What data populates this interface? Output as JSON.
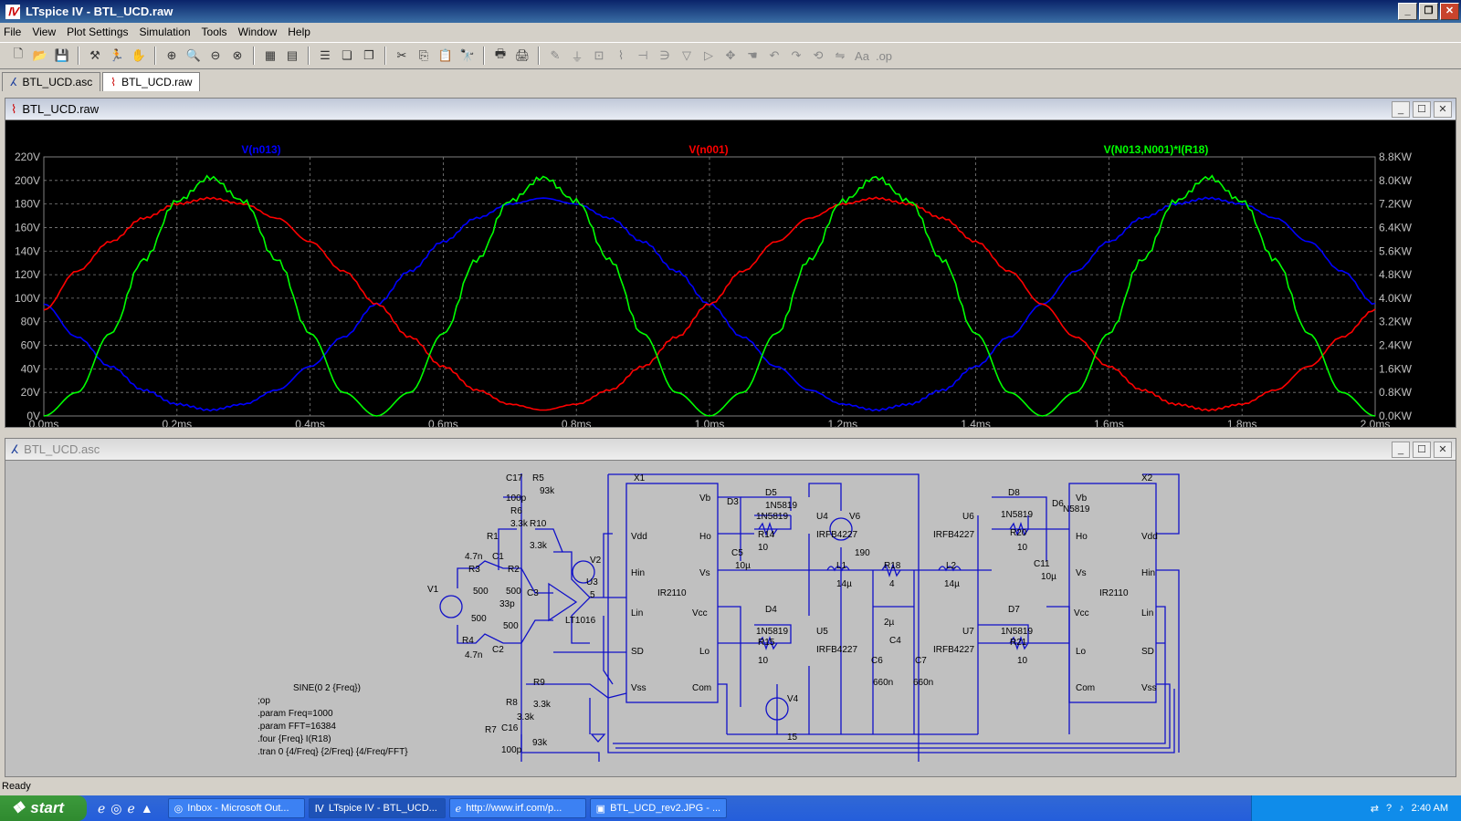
{
  "window": {
    "title": "LTspice IV - BTL_UCD.raw"
  },
  "menu": [
    "File",
    "View",
    "Plot Settings",
    "Simulation",
    "Tools",
    "Window",
    "Help"
  ],
  "tabs": [
    {
      "label": "BTL_UCD.asc"
    },
    {
      "label": "BTL_UCD.raw"
    }
  ],
  "plot_pane": {
    "title": "BTL_UCD.raw"
  },
  "schematic_pane": {
    "title": "BTL_UCD.asc"
  },
  "chart_data": {
    "type": "line",
    "x": [
      0,
      0.05,
      0.1,
      0.15,
      0.2,
      0.25,
      0.3,
      0.35,
      0.4,
      0.45,
      0.5,
      0.55,
      0.6,
      0.65,
      0.7,
      0.75,
      0.8,
      0.85,
      0.9,
      0.95,
      1.0,
      1.05,
      1.1,
      1.15,
      1.2,
      1.25,
      1.3,
      1.35,
      1.4,
      1.45,
      1.5,
      1.55,
      1.6,
      1.65,
      1.7,
      1.75,
      1.8,
      1.85,
      1.9,
      1.95,
      2.0
    ],
    "series": [
      {
        "name": "V(n013)",
        "color": "#0000ff",
        "axis": "left",
        "values": [
          95,
          67,
          42,
          22,
          10,
          5,
          10,
          22,
          42,
          67,
          95,
          123,
          148,
          168,
          180,
          185,
          180,
          168,
          148,
          123,
          95,
          67,
          42,
          22,
          10,
          5,
          10,
          22,
          42,
          67,
          95,
          123,
          148,
          168,
          180,
          185,
          180,
          168,
          148,
          123,
          95
        ]
      },
      {
        "name": "V(n001)",
        "color": "#ff0000",
        "axis": "left",
        "values": [
          90,
          123,
          148,
          168,
          180,
          185,
          180,
          168,
          148,
          123,
          95,
          67,
          42,
          22,
          10,
          5,
          10,
          22,
          42,
          67,
          95,
          123,
          148,
          168,
          180,
          185,
          180,
          168,
          148,
          123,
          95,
          67,
          42,
          22,
          10,
          5,
          10,
          22,
          42,
          67,
          90
        ]
      },
      {
        "name": "V(N013,N001)*I(R18)",
        "color": "#00ff00",
        "axis": "right",
        "values": [
          0,
          0.8,
          2.8,
          5.3,
          7.3,
          8.1,
          7.3,
          5.3,
          2.8,
          0.8,
          0,
          0.8,
          2.8,
          5.3,
          7.3,
          8.1,
          7.3,
          5.3,
          2.8,
          0.8,
          0,
          0.8,
          2.8,
          5.3,
          7.3,
          8.1,
          7.3,
          5.3,
          2.8,
          0.8,
          0,
          0.8,
          2.8,
          5.3,
          7.3,
          8.1,
          7.3,
          5.3,
          2.8,
          0.8,
          0
        ]
      }
    ],
    "xlim": [
      0,
      2.0
    ],
    "ylim": [
      0,
      220
    ],
    "y2lim": [
      0,
      8.8
    ],
    "xticks": [
      "0.0ms",
      "0.2ms",
      "0.4ms",
      "0.6ms",
      "0.8ms",
      "1.0ms",
      "1.2ms",
      "1.4ms",
      "1.6ms",
      "1.8ms",
      "2.0ms"
    ],
    "yticks": [
      "0V",
      "20V",
      "40V",
      "60V",
      "80V",
      "100V",
      "120V",
      "140V",
      "160V",
      "180V",
      "200V",
      "220V"
    ],
    "y2ticks": [
      "0.0KW",
      "0.8KW",
      "1.6KW",
      "2.4KW",
      "3.2KW",
      "4.0KW",
      "4.8KW",
      "5.6KW",
      "6.4KW",
      "7.2KW",
      "8.0KW",
      "8.8KW"
    ],
    "grid": true
  },
  "schematic": {
    "labels": [
      {
        "t": "C17"
      },
      {
        "t": "100p"
      },
      {
        "t": "R5"
      },
      {
        "t": "93k"
      },
      {
        "t": "R6"
      },
      {
        "t": "3.3k"
      },
      {
        "t": "R10"
      },
      {
        "t": "3.3k"
      },
      {
        "t": "R1"
      },
      {
        "t": "4.7n"
      },
      {
        "t": "C1"
      },
      {
        "t": "R3"
      },
      {
        "t": "R2"
      },
      {
        "t": "500"
      },
      {
        "t": "500"
      },
      {
        "t": "V1"
      },
      {
        "t": "C3"
      },
      {
        "t": "33p"
      },
      {
        "t": "V2"
      },
      {
        "t": "U3"
      },
      {
        "t": "5"
      },
      {
        "t": "LT1016"
      },
      {
        "t": "500"
      },
      {
        "t": "500"
      },
      {
        "t": "R4"
      },
      {
        "t": "4.7n"
      },
      {
        "t": "C2"
      },
      {
        "t": "R9"
      },
      {
        "t": "3.3k"
      },
      {
        "t": "R8"
      },
      {
        "t": "3.3k"
      },
      {
        "t": "R7"
      },
      {
        "t": "C16"
      },
      {
        "t": "93k"
      },
      {
        "t": "100p"
      },
      {
        "t": "X1"
      },
      {
        "t": "Vdd"
      },
      {
        "t": "Hin"
      },
      {
        "t": "Lin"
      },
      {
        "t": "SD"
      },
      {
        "t": "Vss"
      },
      {
        "t": "IR2110"
      },
      {
        "t": "Vb"
      },
      {
        "t": "Ho"
      },
      {
        "t": "Vs"
      },
      {
        "t": "Vcc"
      },
      {
        "t": "Lo"
      },
      {
        "t": "Com"
      },
      {
        "t": "D3"
      },
      {
        "t": "D5"
      },
      {
        "t": "1N5819"
      },
      {
        "t": "1N5819"
      },
      {
        "t": "R14"
      },
      {
        "t": "10"
      },
      {
        "t": "C5"
      },
      {
        "t": "10µ"
      },
      {
        "t": "U4"
      },
      {
        "t": "IRFB4227"
      },
      {
        "t": "V6"
      },
      {
        "t": "190"
      },
      {
        "t": "D4"
      },
      {
        "t": "1N5819"
      },
      {
        "t": "R15"
      },
      {
        "t": "10"
      },
      {
        "t": "U5"
      },
      {
        "t": "IRFB4227"
      },
      {
        "t": "L1"
      },
      {
        "t": "14µ"
      },
      {
        "t": "R18"
      },
      {
        "t": "4"
      },
      {
        "t": "L2"
      },
      {
        "t": "14µ"
      },
      {
        "t": "2µ"
      },
      {
        "t": "C4"
      },
      {
        "t": "C6"
      },
      {
        "t": "660n"
      },
      {
        "t": "C7"
      },
      {
        "t": "660n"
      },
      {
        "t": "V4"
      },
      {
        "t": "15"
      },
      {
        "t": "D8"
      },
      {
        "t": "1N5819"
      },
      {
        "t": "D6"
      },
      {
        "t": "N5819"
      },
      {
        "t": "U6"
      },
      {
        "t": "IRFB4227"
      },
      {
        "t": "R20"
      },
      {
        "t": "10"
      },
      {
        "t": "C11"
      },
      {
        "t": "10µ"
      },
      {
        "t": "D7"
      },
      {
        "t": "1N5819"
      },
      {
        "t": "U7"
      },
      {
        "t": "IRFB4227"
      },
      {
        "t": "R21"
      },
      {
        "t": "10"
      },
      {
        "t": "X2"
      },
      {
        "t": "Vb"
      },
      {
        "t": "Ho"
      },
      {
        "t": "Vs"
      },
      {
        "t": "Vcc"
      },
      {
        "t": "Lo"
      },
      {
        "t": "Com"
      },
      {
        "t": "IR2110"
      },
      {
        "t": "Vdd"
      },
      {
        "t": "Hin"
      },
      {
        "t": "Lin"
      },
      {
        "t": "SD"
      },
      {
        "t": "Vss"
      }
    ],
    "directives": [
      "SINE(0 2 {Freq})",
      ";op",
      ".param Freq=1000",
      ".param FFT=16384",
      ".four {Freq} I(R18)",
      ".tran 0 {4/Freq} {2/Freq} {4/Freq/FFT}"
    ]
  },
  "status": "Ready",
  "taskbar": {
    "start": "start",
    "tasks": [
      "Inbox - Microsoft Out...",
      "LTspice IV - BTL_UCD...",
      "http://www.irf.com/p...",
      "BTL_UCD_rev2.JPG - ..."
    ],
    "clock": "2:40 AM"
  }
}
